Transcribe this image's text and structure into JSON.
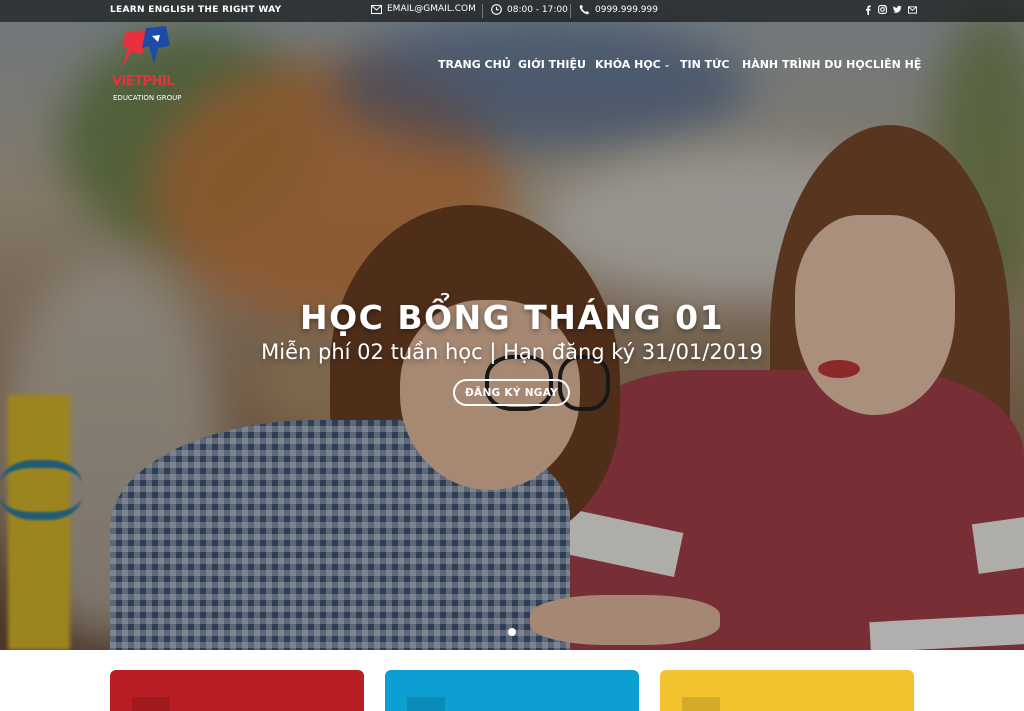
{
  "topbar": {
    "tagline": "LEARN ENGLISH THE RIGHT WAY",
    "email": "EMAIL@GMAIL.COM",
    "hours": "08:00 - 17:00",
    "phone": "0999.999.999",
    "social": [
      "facebook-icon",
      "instagram-icon",
      "twitter-icon",
      "email-icon"
    ]
  },
  "logo": {
    "name": "VIETPHIL",
    "subtitle": "EDUCATION GROUP"
  },
  "nav": {
    "home": "TRANG CHỦ",
    "about": "GIỚI THIỆU",
    "courses": "KHÓA HỌC",
    "news": "TIN TỨC",
    "journey": "HÀNH TRÌNH DU HỌC",
    "contact": "LIÊN HỆ"
  },
  "hero": {
    "title": "HỌC BỔNG THÁNG 01",
    "subtitle": "Miễn phí 02 tuần học | Hạn đăng ký 31/01/2019",
    "cta": "ĐĂNG KÝ NGAY"
  },
  "colors": {
    "card_red": "#b81e23",
    "card_blue": "#0d9fd1",
    "card_yellow": "#f3c22f",
    "brand_red": "#e8313c"
  }
}
